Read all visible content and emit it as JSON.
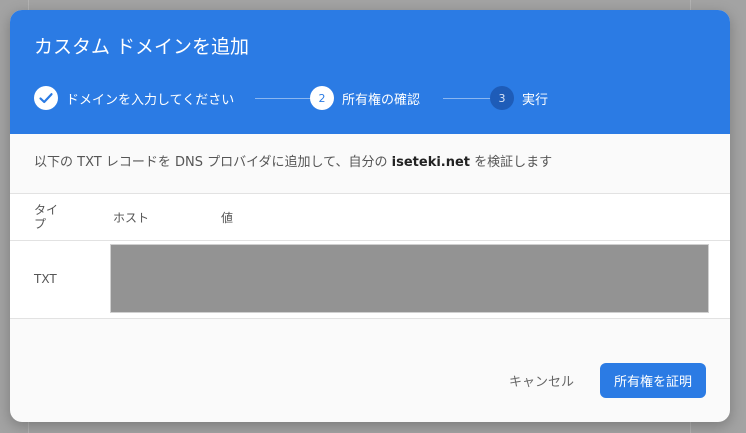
{
  "dialog": {
    "title": "カスタム ドメインを追加"
  },
  "stepper": {
    "steps": [
      {
        "number": "",
        "label": "ドメインを入力してください",
        "state": "done",
        "icon": "checkmark-icon"
      },
      {
        "number": "2",
        "label": "所有権の確認",
        "state": "active"
      },
      {
        "number": "3",
        "label": "実行",
        "state": "pending"
      }
    ]
  },
  "instruction": {
    "prefix": "以下の TXT レコードを DNS プロバイダに追加して、自分の ",
    "domain": "iseteki.net",
    "suffix": " を検証します"
  },
  "table": {
    "headers": {
      "type": "タイプ",
      "host": "ホスト",
      "value": "値"
    },
    "rows": [
      {
        "type": "TXT"
      }
    ]
  },
  "actions": {
    "cancel_label": "キャンセル",
    "verify_label": "所有権を証明"
  },
  "colors": {
    "accent": "#2b7be4",
    "pending_step": "#1e5cb8",
    "redacted": "#939393"
  }
}
